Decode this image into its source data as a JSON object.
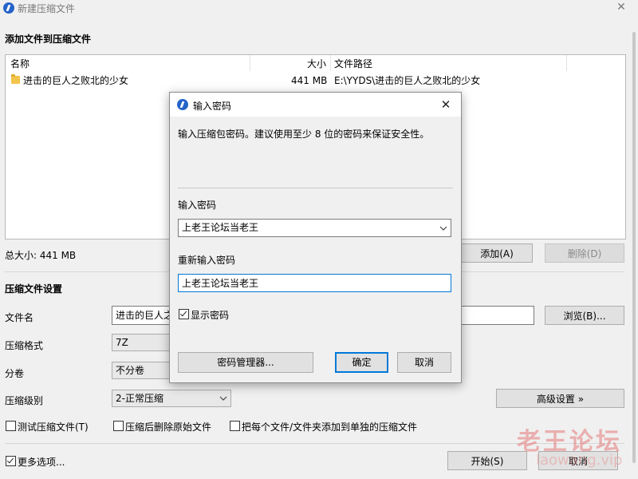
{
  "window": {
    "title": "新建压缩文件",
    "close_glyph": "✕"
  },
  "files_section": {
    "heading": "添加文件到压缩文件",
    "columns": {
      "name": "名称",
      "size": "大小",
      "path": "文件路径"
    },
    "rows": [
      {
        "name": "进击的巨人之败北的少女",
        "size": "441 MB",
        "path": "E:\\YYDS\\进击的巨人之败北的少女"
      }
    ],
    "total_size": "总大小: 441 MB",
    "add_button": "添加(A)",
    "delete_button": "删除(D)"
  },
  "settings": {
    "heading": "压缩文件设置",
    "filename_label": "文件名",
    "filename_value": "进击的巨人之",
    "browse_button": "浏览(B)...",
    "format_label": "压缩格式",
    "format_value": "7Z",
    "split_label": "分卷",
    "split_value": "不分卷",
    "level_label": "压缩级别",
    "level_value": "2-正常压缩",
    "advanced_button": "高级设置 »",
    "test_checkbox": "测试压缩文件(T)",
    "delete_after_checkbox": "压缩后删除原始文件",
    "separate_checkbox": "把每个文件/文件夹添加到单独的压缩文件",
    "more_options_checkbox": "更多选项...",
    "start_button": "开始(S)",
    "cancel_button": "取消"
  },
  "password_dialog": {
    "title": "输入密码",
    "close_glyph": "✕",
    "description": "输入压缩包密码。建议使用至少 8 位的密码来保证安全性。",
    "password_label": "输入密码",
    "password_value": "上老王论坛当老王",
    "reenter_label": "重新输入密码",
    "reenter_value": "上老王论坛当老王",
    "show_password": "显示密码",
    "manager_button": "密码管理器...",
    "ok_button": "确定",
    "cancel_button": "取消"
  },
  "watermark": {
    "text": "老王论坛",
    "url": "laowang.vip"
  }
}
